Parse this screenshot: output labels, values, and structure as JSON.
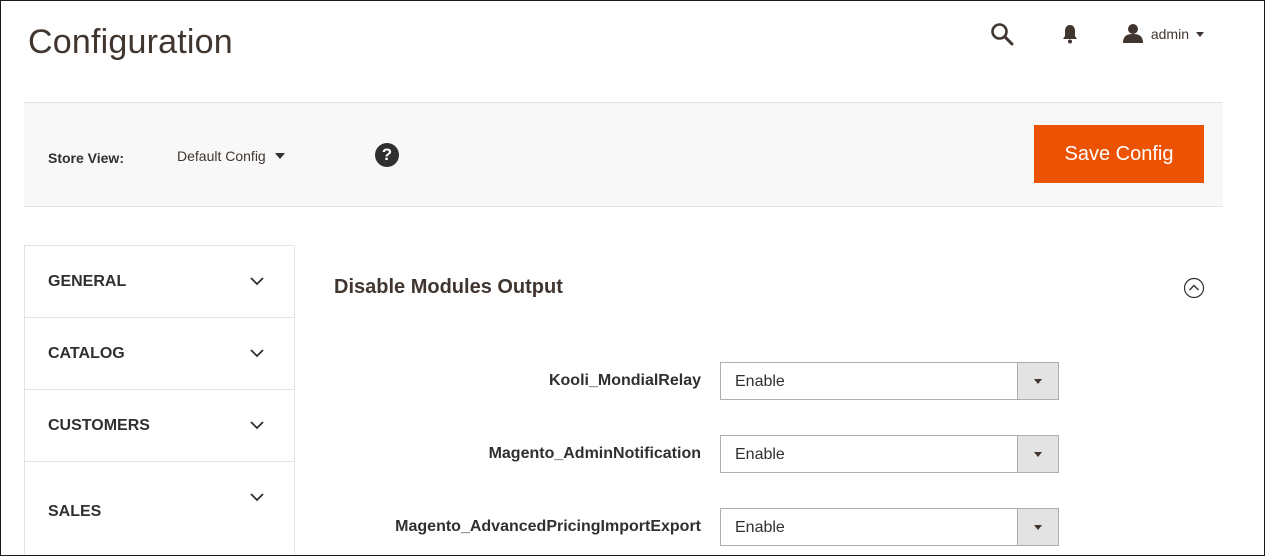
{
  "page": {
    "title": "Configuration"
  },
  "header": {
    "icons": {
      "search": "search-icon",
      "notifications": "bell-icon",
      "user": "user-icon"
    },
    "user_name": "admin"
  },
  "toolbar": {
    "store_view_label": "Store View:",
    "store_view_value": "Default Config",
    "help_label": "?",
    "save_label": "Save Config"
  },
  "sidebar": {
    "items": [
      {
        "label": "GENERAL"
      },
      {
        "label": "CATALOG"
      },
      {
        "label": "CUSTOMERS"
      },
      {
        "label": "SALES"
      }
    ]
  },
  "section": {
    "title": "Disable Modules Output",
    "fields": [
      {
        "label": "Kooli_MondialRelay",
        "value": "Enable"
      },
      {
        "label": "Magento_AdminNotification",
        "value": "Enable"
      },
      {
        "label": "Magento_AdvancedPricingImportExport",
        "value": "Enable"
      }
    ]
  },
  "colors": {
    "accent": "#eb5202",
    "text": "#303030",
    "toolbar_bg": "#f8f8f8",
    "border": "#e3e3e3"
  }
}
